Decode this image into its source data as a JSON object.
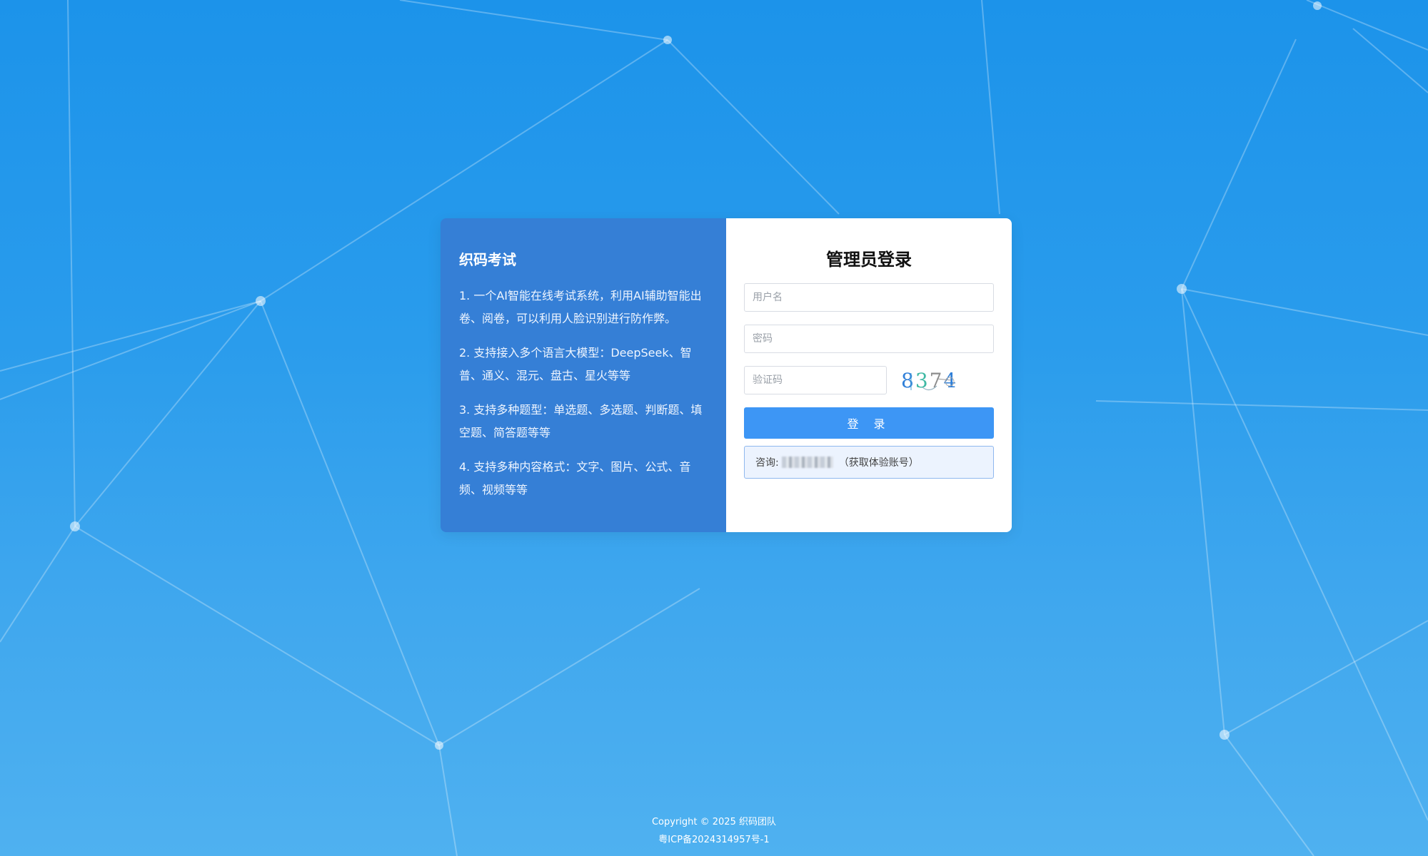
{
  "intro": {
    "title": "织码考试",
    "items": [
      "1. 一个AI智能在线考试系统，利用AI辅助智能出卷、阅卷，可以利用人脸识别进行防作弊。",
      "2. 支持接入多个语言大模型：DeepSeek、智普、通义、混元、盘古、星火等等",
      "3. 支持多种题型：单选题、多选题、判断题、填空题、简答题等等",
      "4. 支持多种内容格式：文字、图片、公式、音频、视频等等"
    ]
  },
  "login": {
    "title": "管理员登录",
    "username_placeholder": "用户名",
    "password_placeholder": "密码",
    "captcha_placeholder": "验证码",
    "captcha_chars": [
      "8",
      "3",
      "7",
      "4"
    ],
    "captcha_colors": [
      "#2f7fd8",
      "#3fb9a4",
      "#8c8c8c",
      "#2f7fd8"
    ],
    "login_button": "登 录",
    "consult_label": "咨询:",
    "consult_hint": "（获取体验账号）"
  },
  "footer": {
    "copyright": "Copyright © 2025 织码团队",
    "icp": "粤ICP备2024314957号-1"
  },
  "colors": {
    "background": "#2a9cec",
    "intro_panel": "#357fd6",
    "button": "#3d96f5"
  }
}
